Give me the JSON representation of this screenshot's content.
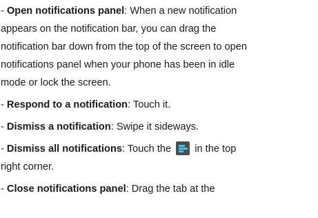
{
  "items": [
    {
      "prefix": "- ",
      "term": "Open notifications panel",
      "sep": ": ",
      "lines": [
        "When a new notification",
        "appears on the notification bar, you can drag the",
        "notification bar down from the top of the screen to open",
        "notifications panel when your phone has been in idle",
        "mode or lock the screen."
      ]
    },
    {
      "prefix": "- ",
      "term": "Respond to a notification",
      "sep": ": ",
      "text": "Touch it."
    },
    {
      "prefix": "- ",
      "term": "Dismiss a notification",
      "sep": ": ",
      "text": "Swipe it sideways."
    },
    {
      "prefix": "- ",
      "term": "Dismiss all notifications",
      "sep": ": ",
      "before_icon": "Touch the",
      "icon": "clear-all-icon",
      "after_icon": "in the top",
      "line2": "right corner."
    },
    {
      "prefix": "- ",
      "term": "Close notifications panel",
      "sep": ": ",
      "text": "Drag the tab at the"
    }
  ],
  "colors": {
    "text": "#1a1a1a",
    "icon_background": "#4d4d4d",
    "icon_bars": "#3fc5ea"
  }
}
